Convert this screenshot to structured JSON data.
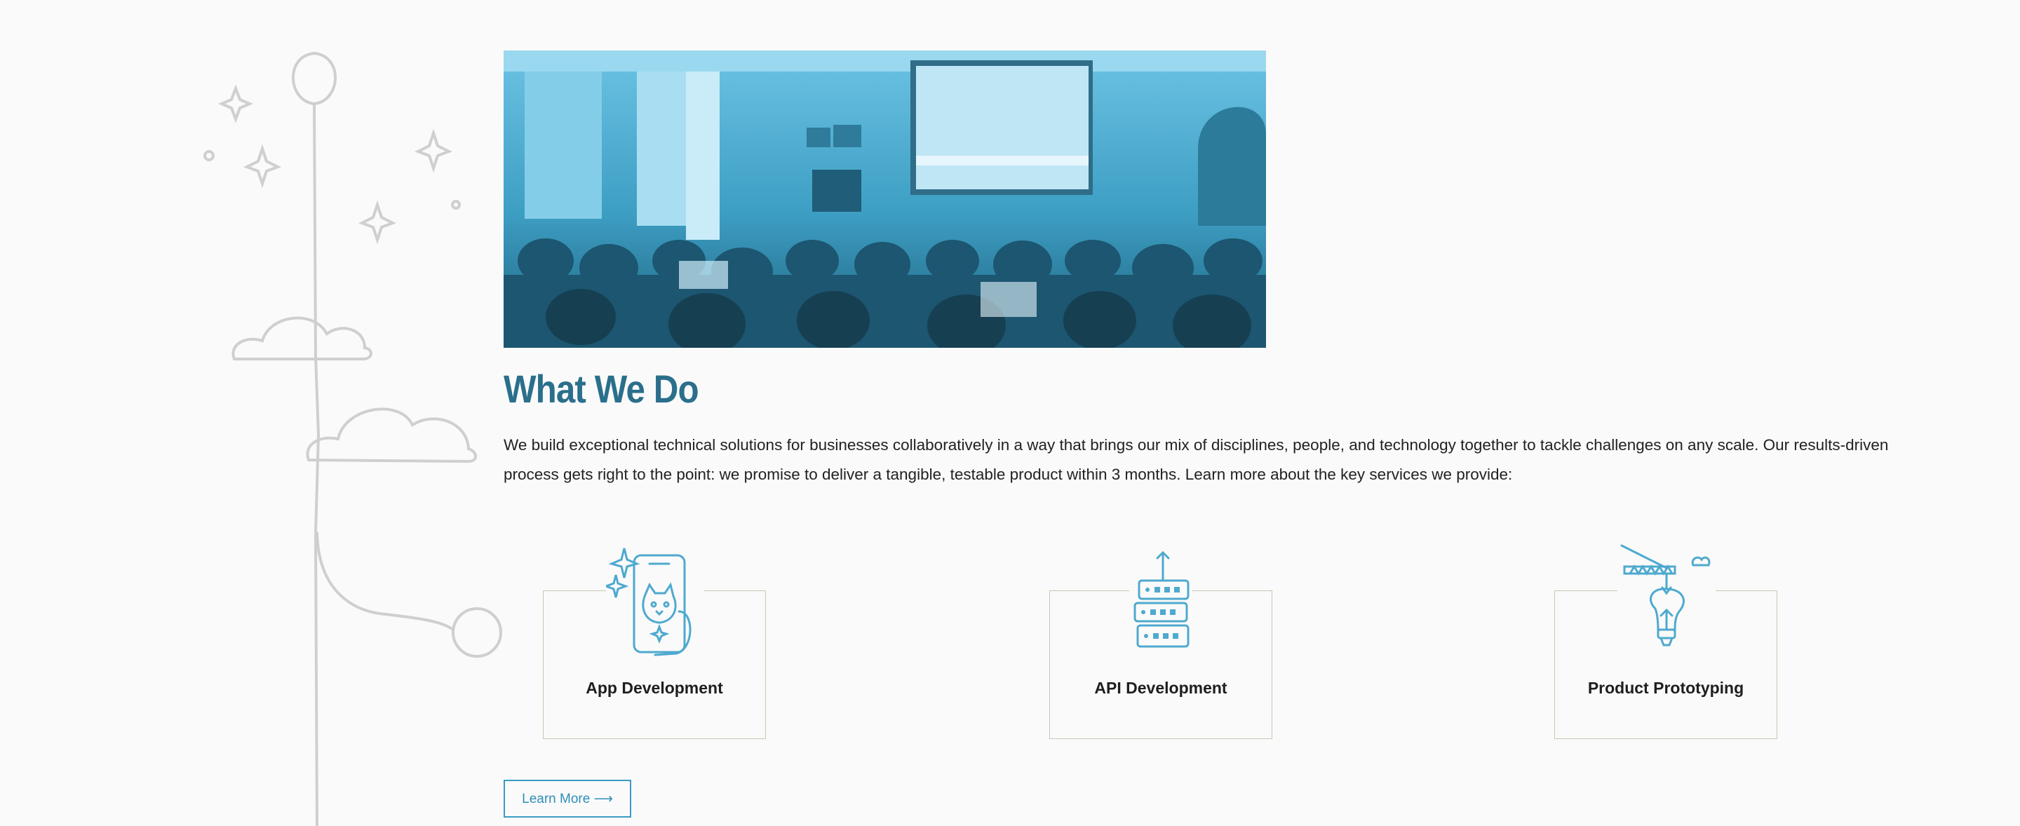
{
  "section": {
    "title": "What We Do",
    "intro": "We build exceptional technical solutions for businesses collaboratively in a way that brings our mix of disciplines, people, and technology together to tackle challenges on any scale. Our results-driven process gets right to the point: we promise to deliver a tangible, testable product within 3 months. Learn more about the key services we provide:"
  },
  "services": [
    {
      "label": "App Development",
      "icon": "phone-cat-icon"
    },
    {
      "label": "API Development",
      "icon": "server-stack-icon"
    },
    {
      "label": "Product Prototyping",
      "icon": "crane-lightbulb-icon"
    }
  ],
  "cta": {
    "label": "Learn More ⟶"
  },
  "colors": {
    "accent": "#2a6f8c",
    "icon_blue": "#4ea9cf",
    "photo_tint": "#3d9ec3",
    "card_border": "#c9c5b3",
    "doodle": "#cccccc"
  }
}
